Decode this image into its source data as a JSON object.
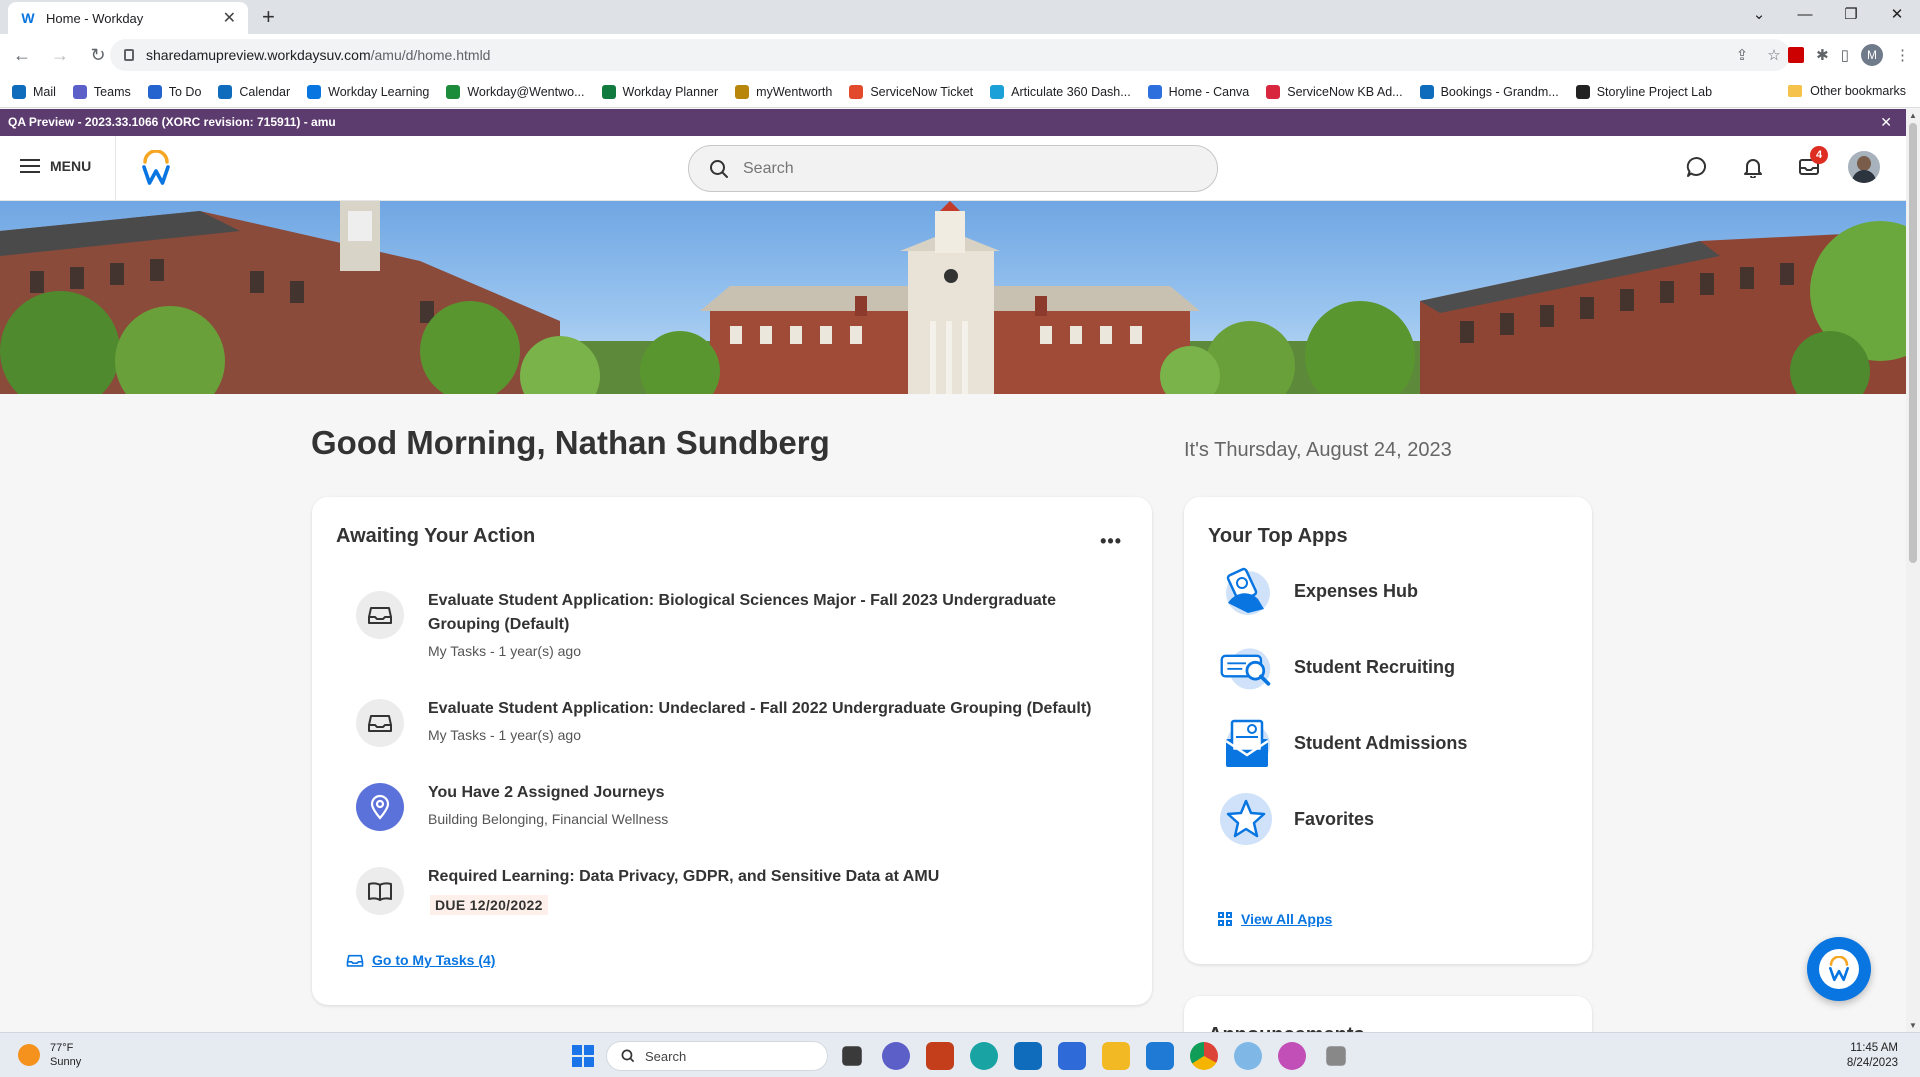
{
  "browser": {
    "tab_title": "Home - Workday",
    "url_host": "sharedamupreview.workdaysuv.com",
    "url_path": "/amu/d/home.htmld",
    "bookmarks": [
      {
        "label": "Mail",
        "color": "#0f6cbd"
      },
      {
        "label": "Teams",
        "color": "#5b5fc7"
      },
      {
        "label": "To Do",
        "color": "#2564cf"
      },
      {
        "label": "Calendar",
        "color": "#0f6cbd"
      },
      {
        "label": "Workday Learning",
        "color": "#0875e1"
      },
      {
        "label": "Workday@Wentwo...",
        "color": "#1d8c3a"
      },
      {
        "label": "Workday Planner",
        "color": "#117a3e"
      },
      {
        "label": "myWentworth",
        "color": "#b8860b"
      },
      {
        "label": "ServiceNow Ticket",
        "color": "#e24a2b"
      },
      {
        "label": "Articulate 360 Dash...",
        "color": "#1ba0d8"
      },
      {
        "label": "Home - Canva",
        "color": "#2c6fdd"
      },
      {
        "label": "ServiceNow KB Ad...",
        "color": "#d7263d"
      },
      {
        "label": "Bookings - Grandm...",
        "color": "#0f6cbd"
      },
      {
        "label": "Storyline Project Lab",
        "color": "#222222"
      }
    ],
    "other_bookmarks": "Other bookmarks",
    "profile_initial": "M"
  },
  "qa_banner": {
    "text": "QA Preview - 2023.33.1066 (XORC revision: 715911) - amu",
    "close": "✕"
  },
  "header": {
    "menu_label": "MENU",
    "search_placeholder": "Search",
    "inbox_badge": "4"
  },
  "greeting": "Good Morning, Nathan Sundberg",
  "date_text": "It's Thursday, August 24, 2023",
  "awaiting": {
    "title": "Awaiting Your Action",
    "tasks": [
      {
        "title": "Evaluate Student Application: Biological Sciences Major - Fall 2023 Undergraduate Grouping (Default)",
        "subtitle": "My Tasks - 1 year(s) ago",
        "icon": "inbox-tray-icon"
      },
      {
        "title": "Evaluate Student Application: Undeclared - Fall 2022 Undergraduate Grouping (Default)",
        "subtitle": "My Tasks - 1 year(s) ago",
        "icon": "inbox-tray-icon"
      },
      {
        "title": "You Have 2 Assigned Journeys",
        "subtitle": "Building Belonging, Financial Wellness",
        "icon": "map-pin-icon"
      },
      {
        "title": "Required Learning: Data Privacy, GDPR, and Sensitive Data at AMU",
        "due": "DUE 12/20/2022",
        "icon": "book-icon"
      }
    ],
    "go_to_tasks": "Go to My Tasks (4)"
  },
  "top_apps": {
    "title": "Your Top Apps",
    "apps": [
      {
        "label": "Expenses Hub",
        "icon": "expenses-hub-icon"
      },
      {
        "label": "Student Recruiting",
        "icon": "student-recruiting-icon"
      },
      {
        "label": "Student Admissions",
        "icon": "student-admissions-icon"
      },
      {
        "label": "Favorites",
        "icon": "star-icon"
      }
    ],
    "view_all": "View All Apps"
  },
  "announcements_title": "Announcements",
  "taskbar": {
    "temp": "77°F",
    "condition": "Sunny",
    "search": "Search",
    "time": "11:45 AM",
    "date": "8/24/2023"
  },
  "colors": {
    "accent": "#0875e1",
    "qa_banner": "#5c3b6f",
    "journey": "#5b72db",
    "badge": "#de2e21"
  }
}
